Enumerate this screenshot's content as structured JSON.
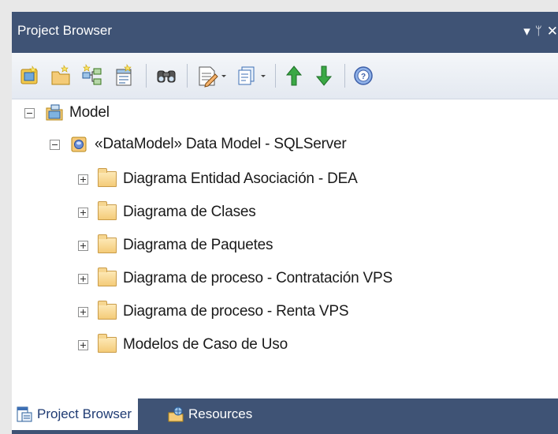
{
  "window": {
    "title": "Project Browser",
    "controls": {
      "menu": "▾",
      "pin": "ᛘ",
      "close": "✕"
    }
  },
  "toolbar": {
    "buttons": [
      {
        "icon": "new-model-icon"
      },
      {
        "icon": "new-package-icon"
      },
      {
        "icon": "new-diagram-icon"
      },
      {
        "icon": "new-element-icon"
      },
      {
        "icon": "find-icon"
      },
      {
        "icon": "document-dropdown-icon"
      },
      {
        "icon": "copy-dropdown-icon"
      },
      {
        "icon": "move-up-icon"
      },
      {
        "icon": "move-down-icon"
      },
      {
        "icon": "help-icon"
      }
    ]
  },
  "tree": {
    "root": {
      "label": "Model",
      "expanded": true
    },
    "datamodel": {
      "label": "«DataModel» Data Model - SQLServer",
      "expanded": true
    },
    "folders": [
      {
        "label": "Diagrama Entidad Asociación - DEA"
      },
      {
        "label": "Diagrama de Clases"
      },
      {
        "label": "Diagrama de Paquetes"
      },
      {
        "label": "Diagrama de proceso - Contratación VPS"
      },
      {
        "label": "Diagrama de proceso - Renta VPS"
      },
      {
        "label": "Modelos de Caso de Uso"
      }
    ]
  },
  "tabs": [
    {
      "label": "Project Browser",
      "active": true
    },
    {
      "label": "Resources",
      "active": false
    }
  ],
  "colors": {
    "titlebar": "#3f5375",
    "toolbar": "#e4e9f1",
    "active_tab_text": "#1f3b73"
  }
}
